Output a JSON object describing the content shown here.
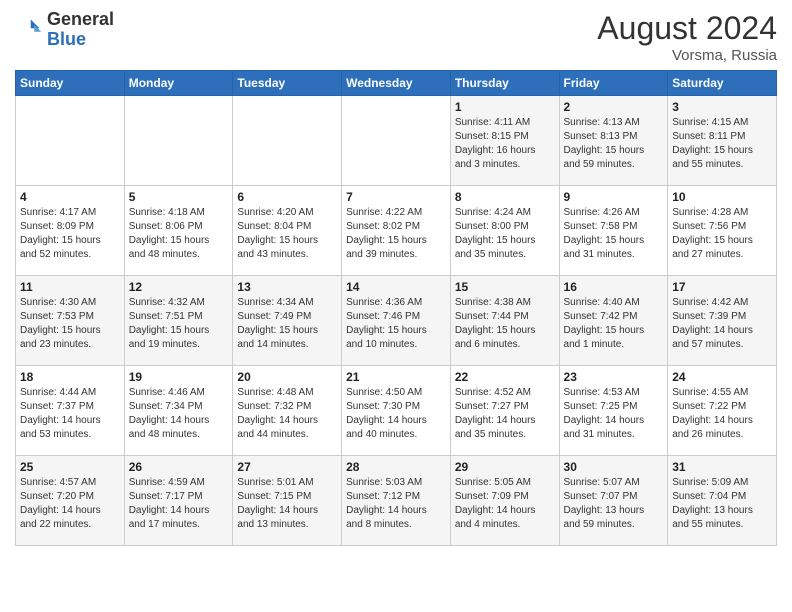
{
  "header": {
    "logo_general": "General",
    "logo_blue": "Blue",
    "month_year": "August 2024",
    "location": "Vorsma, Russia"
  },
  "weekdays": [
    "Sunday",
    "Monday",
    "Tuesday",
    "Wednesday",
    "Thursday",
    "Friday",
    "Saturday"
  ],
  "weeks": [
    [
      {
        "day": "",
        "info": ""
      },
      {
        "day": "",
        "info": ""
      },
      {
        "day": "",
        "info": ""
      },
      {
        "day": "",
        "info": ""
      },
      {
        "day": "1",
        "info": "Sunrise: 4:11 AM\nSunset: 8:15 PM\nDaylight: 16 hours\nand 3 minutes."
      },
      {
        "day": "2",
        "info": "Sunrise: 4:13 AM\nSunset: 8:13 PM\nDaylight: 15 hours\nand 59 minutes."
      },
      {
        "day": "3",
        "info": "Sunrise: 4:15 AM\nSunset: 8:11 PM\nDaylight: 15 hours\nand 55 minutes."
      }
    ],
    [
      {
        "day": "4",
        "info": "Sunrise: 4:17 AM\nSunset: 8:09 PM\nDaylight: 15 hours\nand 52 minutes."
      },
      {
        "day": "5",
        "info": "Sunrise: 4:18 AM\nSunset: 8:06 PM\nDaylight: 15 hours\nand 48 minutes."
      },
      {
        "day": "6",
        "info": "Sunrise: 4:20 AM\nSunset: 8:04 PM\nDaylight: 15 hours\nand 43 minutes."
      },
      {
        "day": "7",
        "info": "Sunrise: 4:22 AM\nSunset: 8:02 PM\nDaylight: 15 hours\nand 39 minutes."
      },
      {
        "day": "8",
        "info": "Sunrise: 4:24 AM\nSunset: 8:00 PM\nDaylight: 15 hours\nand 35 minutes."
      },
      {
        "day": "9",
        "info": "Sunrise: 4:26 AM\nSunset: 7:58 PM\nDaylight: 15 hours\nand 31 minutes."
      },
      {
        "day": "10",
        "info": "Sunrise: 4:28 AM\nSunset: 7:56 PM\nDaylight: 15 hours\nand 27 minutes."
      }
    ],
    [
      {
        "day": "11",
        "info": "Sunrise: 4:30 AM\nSunset: 7:53 PM\nDaylight: 15 hours\nand 23 minutes."
      },
      {
        "day": "12",
        "info": "Sunrise: 4:32 AM\nSunset: 7:51 PM\nDaylight: 15 hours\nand 19 minutes."
      },
      {
        "day": "13",
        "info": "Sunrise: 4:34 AM\nSunset: 7:49 PM\nDaylight: 15 hours\nand 14 minutes."
      },
      {
        "day": "14",
        "info": "Sunrise: 4:36 AM\nSunset: 7:46 PM\nDaylight: 15 hours\nand 10 minutes."
      },
      {
        "day": "15",
        "info": "Sunrise: 4:38 AM\nSunset: 7:44 PM\nDaylight: 15 hours\nand 6 minutes."
      },
      {
        "day": "16",
        "info": "Sunrise: 4:40 AM\nSunset: 7:42 PM\nDaylight: 15 hours\nand 1 minute."
      },
      {
        "day": "17",
        "info": "Sunrise: 4:42 AM\nSunset: 7:39 PM\nDaylight: 14 hours\nand 57 minutes."
      }
    ],
    [
      {
        "day": "18",
        "info": "Sunrise: 4:44 AM\nSunset: 7:37 PM\nDaylight: 14 hours\nand 53 minutes."
      },
      {
        "day": "19",
        "info": "Sunrise: 4:46 AM\nSunset: 7:34 PM\nDaylight: 14 hours\nand 48 minutes."
      },
      {
        "day": "20",
        "info": "Sunrise: 4:48 AM\nSunset: 7:32 PM\nDaylight: 14 hours\nand 44 minutes."
      },
      {
        "day": "21",
        "info": "Sunrise: 4:50 AM\nSunset: 7:30 PM\nDaylight: 14 hours\nand 40 minutes."
      },
      {
        "day": "22",
        "info": "Sunrise: 4:52 AM\nSunset: 7:27 PM\nDaylight: 14 hours\nand 35 minutes."
      },
      {
        "day": "23",
        "info": "Sunrise: 4:53 AM\nSunset: 7:25 PM\nDaylight: 14 hours\nand 31 minutes."
      },
      {
        "day": "24",
        "info": "Sunrise: 4:55 AM\nSunset: 7:22 PM\nDaylight: 14 hours\nand 26 minutes."
      }
    ],
    [
      {
        "day": "25",
        "info": "Sunrise: 4:57 AM\nSunset: 7:20 PM\nDaylight: 14 hours\nand 22 minutes."
      },
      {
        "day": "26",
        "info": "Sunrise: 4:59 AM\nSunset: 7:17 PM\nDaylight: 14 hours\nand 17 minutes."
      },
      {
        "day": "27",
        "info": "Sunrise: 5:01 AM\nSunset: 7:15 PM\nDaylight: 14 hours\nand 13 minutes."
      },
      {
        "day": "28",
        "info": "Sunrise: 5:03 AM\nSunset: 7:12 PM\nDaylight: 14 hours\nand 8 minutes."
      },
      {
        "day": "29",
        "info": "Sunrise: 5:05 AM\nSunset: 7:09 PM\nDaylight: 14 hours\nand 4 minutes."
      },
      {
        "day": "30",
        "info": "Sunrise: 5:07 AM\nSunset: 7:07 PM\nDaylight: 13 hours\nand 59 minutes."
      },
      {
        "day": "31",
        "info": "Sunrise: 5:09 AM\nSunset: 7:04 PM\nDaylight: 13 hours\nand 55 minutes."
      }
    ]
  ]
}
